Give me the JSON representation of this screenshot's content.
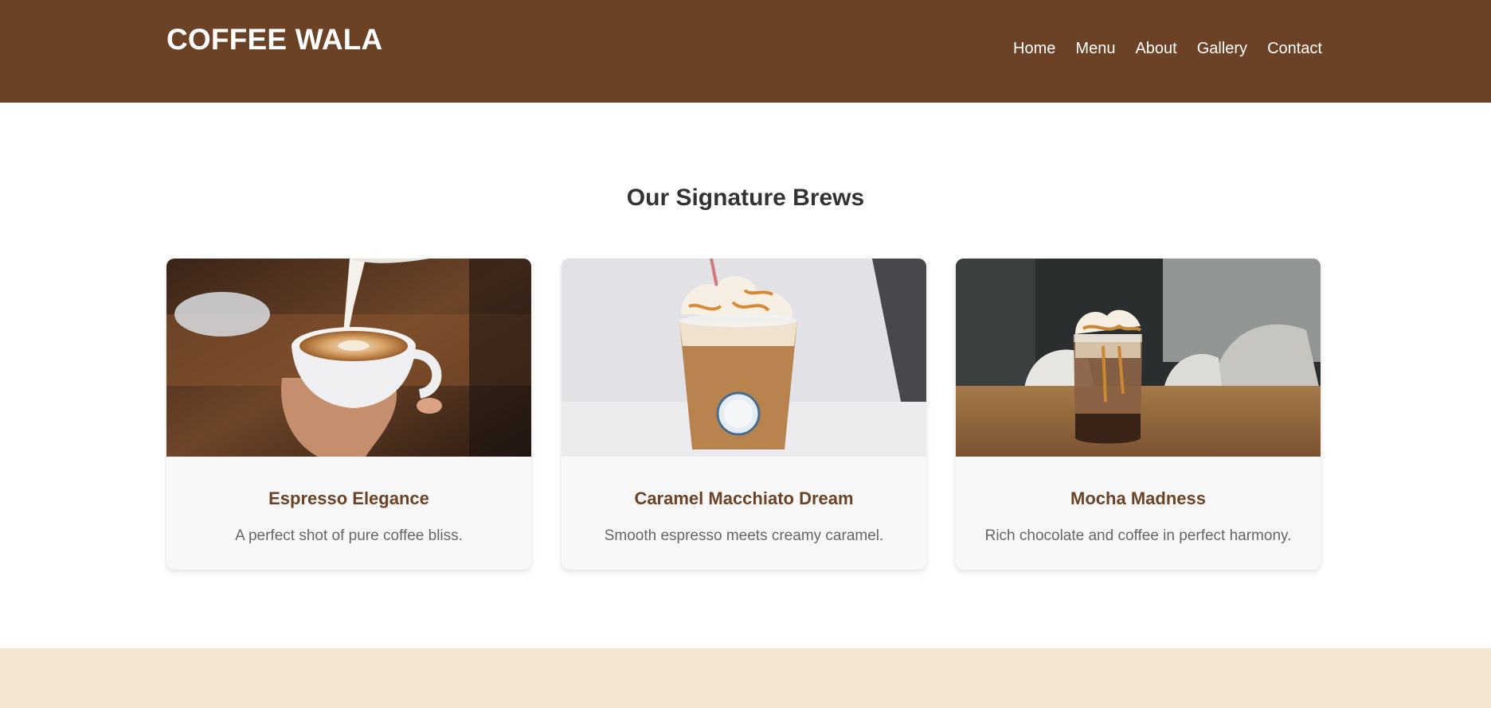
{
  "header": {
    "logo": "COFFEE WALA",
    "nav": [
      "Home",
      "Menu",
      "About",
      "Gallery",
      "Contact"
    ]
  },
  "main": {
    "title": "Our Signature Brews",
    "cards": [
      {
        "title": "Espresso Elegance",
        "description": "A perfect shot of pure coffee bliss.",
        "image": "latte-art-photo"
      },
      {
        "title": "Caramel Macchiato Dream",
        "description": "Smooth espresso meets creamy caramel.",
        "image": "iced-caramel-frappe-photo"
      },
      {
        "title": "Mocha Madness",
        "description": "Rich chocolate and coffee in perfect harmony.",
        "image": "iced-mocha-jar-photo"
      }
    ]
  },
  "colors": {
    "header_bg": "#6b4226",
    "accent": "#6b4226",
    "footer_bg": "#f5e6d3",
    "card_bg": "#f8f8f8"
  }
}
